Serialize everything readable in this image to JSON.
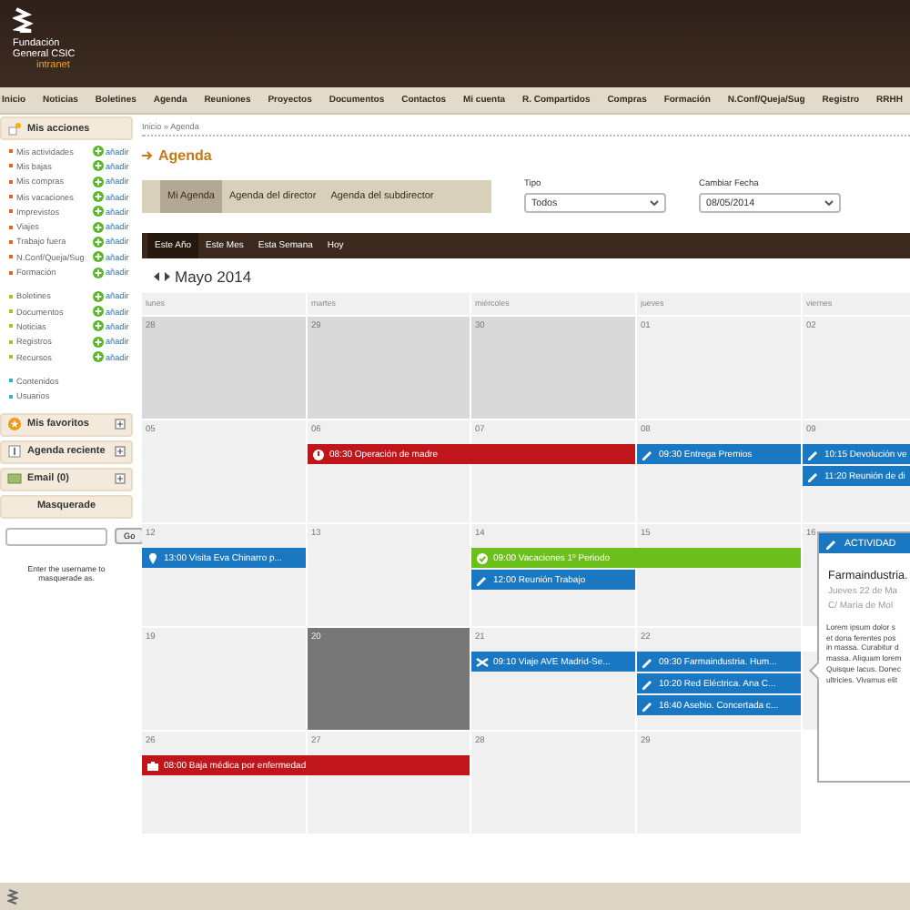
{
  "header": {
    "logo_lines": [
      "Fundación",
      "General CSIC"
    ],
    "logo_sub": "intranet"
  },
  "nav": [
    "Inicio",
    "Noticias",
    "Boletines",
    "Agenda",
    "Reuniones",
    "Proyectos",
    "Documentos",
    "Contactos",
    "Mi cuenta",
    "R. Compartidos",
    "Compras",
    "Formación",
    "N.Conf/Queja/Sug",
    "Registro",
    "RRHH"
  ],
  "sidebar": {
    "actions": {
      "title": "Mis acciones",
      "groups": [
        {
          "color": "#e8641e",
          "items": [
            {
              "label": "Mis actividades",
              "add": "añadir"
            },
            {
              "label": "Mis bajas",
              "add": "añadir"
            },
            {
              "label": "Mis compras",
              "add": "añadir"
            },
            {
              "label": "Mis vacaciones",
              "add": "añadir"
            },
            {
              "label": "Imprevistos",
              "add": "añadir"
            },
            {
              "label": "Viajes",
              "add": "añadir"
            },
            {
              "label": "Trabajo fuera",
              "add": "añadir"
            },
            {
              "label": "N.Conf/Queja/Sug",
              "add": "añadir"
            },
            {
              "label": "Formación",
              "add": "añadir"
            }
          ]
        },
        {
          "color": "#a8c41a",
          "items": [
            {
              "label": "Boletines",
              "add": "añadir"
            },
            {
              "label": "Documentos",
              "add": "añadir"
            },
            {
              "label": "Noticias",
              "add": "añadir"
            },
            {
              "label": "Registros",
              "add": "añadir"
            },
            {
              "label": "Recursos",
              "add": "añadir"
            }
          ]
        },
        {
          "color": "#2ab3d6",
          "items": [
            {
              "label": "Contenidos"
            },
            {
              "label": "Usuarios"
            }
          ]
        }
      ]
    },
    "panels": [
      {
        "title": "Mis favoritos",
        "kind": "star"
      },
      {
        "title": "Agenda reciente",
        "kind": "agenda"
      },
      {
        "title": "Email (0)",
        "kind": "email"
      }
    ],
    "masquerade": {
      "title": "Masquerade",
      "button": "Go",
      "help": "Enter the username to masquerade as."
    }
  },
  "breadcrumb": "Inicio » Agenda",
  "page_title": "Agenda",
  "tabs": [
    {
      "label": "Mi Agenda",
      "selected": true
    },
    {
      "label": "Agenda del director",
      "selected": false
    },
    {
      "label": "Agenda del subdirector",
      "selected": false
    }
  ],
  "filters": [
    {
      "label": "Tipo",
      "value": "Todos"
    },
    {
      "label": "Cambiar Fecha",
      "value": "08/05/2014"
    }
  ],
  "calendar": {
    "views": [
      {
        "label": "Este Año",
        "selected": true
      },
      {
        "label": "Este Mes",
        "selected": false
      },
      {
        "label": "Esta Semana",
        "selected": false
      },
      {
        "label": "Hoy",
        "selected": false
      }
    ],
    "month": "Mayo 2014",
    "weekdays": [
      "lunes",
      "martes",
      "miércoles",
      "jueves",
      "viernes"
    ],
    "weeks": [
      {
        "days": [
          {
            "label": "28",
            "other_month": true,
            "selected": false
          },
          {
            "label": "29",
            "other_month": true,
            "selected": false
          },
          {
            "label": "30",
            "other_month": true,
            "selected": false
          },
          {
            "label": "01",
            "other_month": false,
            "selected": false
          },
          {
            "label": "02",
            "other_month": false,
            "selected": false
          }
        ]
      },
      {
        "days": [
          {
            "label": "05",
            "other_month": false,
            "selected": false
          },
          {
            "label": "06",
            "other_month": false,
            "selected": false,
            "events": [
              {
                "time": "08:30",
                "title": "Operación de madre",
                "kind": "alert",
                "color": "#c0151a",
                "continues": true
              }
            ]
          },
          {
            "label": "07",
            "other_month": false,
            "selected": false
          },
          {
            "label": "08",
            "other_month": false,
            "selected": false,
            "events": [
              {
                "time": "09:30",
                "title": "Entrega Premios",
                "kind": "pencil",
                "color": "#1a78c2",
                "continues": false
              }
            ]
          },
          {
            "label": "09",
            "other_month": false,
            "selected": false,
            "events": [
              {
                "time": "10:15",
                "title": "Devolución ve",
                "kind": "pencil",
                "color": "#1a78c2",
                "continues": false
              },
              {
                "time": "11:20",
                "title": "Reunión de di",
                "kind": "pencil",
                "color": "#1a78c2",
                "continues": false
              }
            ]
          }
        ]
      },
      {
        "days": [
          {
            "label": "12",
            "other_month": false,
            "selected": false,
            "events": [
              {
                "time": "13:00",
                "title": "Visita Eva Chinarro p...",
                "kind": "pin",
                "color": "#1a78c2",
                "continues": false
              }
            ]
          },
          {
            "label": "13",
            "other_month": false,
            "selected": false
          },
          {
            "label": "14",
            "other_month": false,
            "selected": false,
            "events": [
              {
                "time": "09:00",
                "title": "Vacaciones 1º Periodo",
                "kind": "check",
                "color": "#6cbf1a",
                "continues": true
              },
              {
                "time": "12:00",
                "title": "Reunión Trabajo",
                "kind": "pencil",
                "color": "#1a78c2",
                "continues": false
              }
            ]
          },
          {
            "label": "15",
            "other_month": false,
            "selected": false
          },
          {
            "label": "16",
            "other_month": false,
            "selected": false
          }
        ]
      },
      {
        "days": [
          {
            "label": "19",
            "other_month": false,
            "selected": false
          },
          {
            "label": "20",
            "other_month": false,
            "selected": true
          },
          {
            "label": "21",
            "other_month": false,
            "selected": false,
            "events": [
              {
                "time": "09:10",
                "title": "Viaje AVE Madrid-Se...",
                "kind": "plane",
                "color": "#1a78c2",
                "continues": false
              }
            ]
          },
          {
            "label": "22",
            "other_month": false,
            "selected": false,
            "events": [
              {
                "time": "09:30",
                "title": "Farmaindustria. Hum...",
                "kind": "pencil",
                "color": "#1a78c2",
                "continues": false
              },
              {
                "time": "10:20",
                "title": "Red Eléctrica. Ana C...",
                "kind": "pencil",
                "color": "#1a78c2",
                "continues": false
              },
              {
                "time": "16:40",
                "title": "Asebio. Concertada c...",
                "kind": "pencil",
                "color": "#1a78c2",
                "continues": false
              }
            ]
          },
          {
            "other_month": false,
            "selected": false
          }
        ]
      },
      {
        "days": [
          {
            "label": "26",
            "other_month": false,
            "selected": false,
            "events": [
              {
                "time": "08:00",
                "title": "Baja médica por enfermedad",
                "kind": "medical",
                "color": "#c0151a",
                "continues": true
              }
            ]
          },
          {
            "label": "27",
            "other_month": false,
            "selected": false
          },
          {
            "label": "28",
            "other_month": false,
            "selected": false
          },
          {
            "label": "29",
            "other_month": false,
            "selected": false
          }
        ]
      }
    ],
    "popup": {
      "header": "ACTIVIDAD",
      "title": "Farmaindustria.",
      "lines": [
        "Jueves 22 de Ma",
        "C/ María de Mol"
      ],
      "body": [
        "Lorem ipsum dolor s",
        "et dona ferentes pos",
        "in massa. Curabitur d",
        "massa. Aliquam lorem",
        "Quisque lacus. Donec",
        "ultricies. Vivamus elit"
      ]
    }
  }
}
